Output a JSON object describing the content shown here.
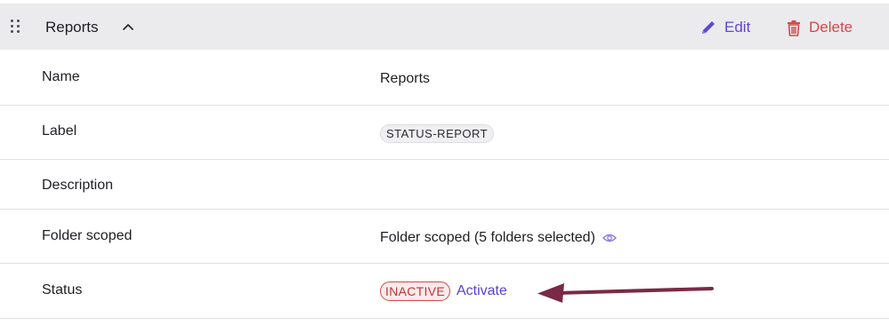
{
  "header": {
    "title": "Reports",
    "edit_label": "Edit",
    "delete_label": "Delete"
  },
  "rows": [
    {
      "key": "Name",
      "value": "Reports"
    },
    {
      "key": "Label",
      "value": "STATUS-REPORT"
    },
    {
      "key": "Description",
      "value": ""
    },
    {
      "key": "Folder scoped",
      "value": "Folder scoped (5 folders selected)"
    },
    {
      "key": "Status",
      "badge": "INACTIVE",
      "action": "Activate"
    }
  ],
  "icons": {
    "drag": "drag-handle-icon",
    "collapse": "chevron-up-icon",
    "edit": "pencil-icon",
    "delete": "trash-icon",
    "view": "eye-icon",
    "annotation": "arrow-left-icon"
  },
  "colors": {
    "accent": "#6146d1",
    "danger": "#d04a48",
    "header_bg": "#ebebee",
    "annotation_arrow": "#7a2946"
  }
}
